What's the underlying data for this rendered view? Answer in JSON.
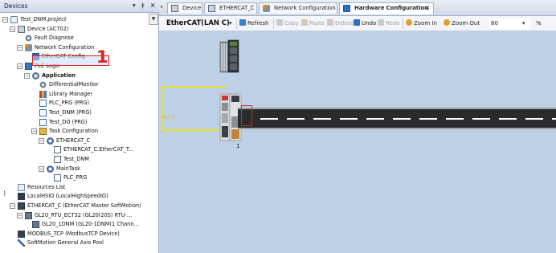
{
  "devices_panel": {
    "title": "Devices",
    "pin_icon": "pin-icon",
    "close_icon": "close-icon",
    "items": [
      {
        "label": "Test_DNM.project",
        "depth": 0,
        "toggle": "−",
        "icon": "project-icon",
        "italic": true
      },
      {
        "label": "Device (AC702)",
        "depth": 1,
        "toggle": "−",
        "icon": "device-icon"
      },
      {
        "label": "Fault Diagnose",
        "depth": 2,
        "toggle": "",
        "icon": "gear-icon"
      },
      {
        "label": "Network Configuration",
        "depth": 2,
        "toggle": "−",
        "icon": "network-icon"
      },
      {
        "label": "EtherCAT Config",
        "depth": 3,
        "toggle": "",
        "icon": "ethercat-icon"
      },
      {
        "label": "PLC Logic",
        "depth": 2,
        "toggle": "−",
        "icon": "plc-icon"
      },
      {
        "label": "Application",
        "depth": 3,
        "toggle": "−",
        "icon": "application-icon",
        "bold": true
      },
      {
        "label": "DifferentialMonitor",
        "depth": 4,
        "toggle": "",
        "icon": "gear-icon"
      },
      {
        "label": "Library Manager",
        "depth": 4,
        "toggle": "",
        "icon": "library-icon"
      },
      {
        "label": "PLC_PRG (PRG)",
        "depth": 4,
        "toggle": "",
        "icon": "pou-icon"
      },
      {
        "label": "Test_DNM (PRG)",
        "depth": 4,
        "toggle": "",
        "icon": "pou-icon"
      },
      {
        "label": "Test_DO (PRG)",
        "depth": 4,
        "toggle": "",
        "icon": "pou-icon"
      },
      {
        "label": "Task Configuration",
        "depth": 4,
        "toggle": "−",
        "icon": "task-config-icon"
      },
      {
        "label": "ETHERCAT_C",
        "depth": 5,
        "toggle": "−",
        "icon": "task-icon"
      },
      {
        "label": "ETHERCAT_C.EtherCAT_T...",
        "depth": 6,
        "toggle": "",
        "icon": "call-icon"
      },
      {
        "label": "Test_DNM",
        "depth": 6,
        "toggle": "",
        "icon": "call-icon"
      },
      {
        "label": "MainTask",
        "depth": 5,
        "toggle": "−",
        "icon": "task-icon"
      },
      {
        "label": "PLC_PRG",
        "depth": 6,
        "toggle": "",
        "icon": "call-icon"
      },
      {
        "label": "Resources List",
        "depth": 1,
        "toggle": "",
        "icon": "resources-icon"
      },
      {
        "label": "LocalHSIO (LocalHighSpeedIO)",
        "depth": 1,
        "toggle": "",
        "icon": "localhsio-icon"
      },
      {
        "label": "ETHERCAT_C (EtherCAT Master SoftMotion)",
        "depth": 1,
        "toggle": "−",
        "icon": "ethercat-master-icon"
      },
      {
        "label": "GL20_RTU_ECT32 (GL20(20S) RTU-...",
        "depth": 2,
        "toggle": "−",
        "icon": "slave-icon"
      },
      {
        "label": "GL20_1DNM (GL20-1DNM(1 Chann...",
        "depth": 3,
        "toggle": "",
        "icon": "slave-icon"
      },
      {
        "label": "MODBUS_TCP (ModbusTCP Device)",
        "depth": 1,
        "toggle": "",
        "icon": "modbus-icon"
      },
      {
        "label": "SoftMotion General Axis Pool",
        "depth": 1,
        "toggle": "",
        "icon": "axis-pool-icon"
      }
    ]
  },
  "annotation": {
    "number": "1"
  },
  "side_mark": ")",
  "tabs": [
    {
      "label": "Device",
      "icon": "device-icon",
      "active": false
    },
    {
      "label": "ETHERCAT_C",
      "icon": "ethercat-icon",
      "active": false
    },
    {
      "label": "Network Configuration",
      "icon": "network-icon",
      "active": false
    },
    {
      "label": "Hardware Configuration",
      "icon": "hardware-config-icon",
      "active": true,
      "close": "×"
    }
  ],
  "toolbar": {
    "selector": "EtherCAT(LAN C)",
    "refresh": "Refresh",
    "copy": "Copy",
    "paste": "Paste",
    "delete": "Delete",
    "undo": "Undo",
    "redo": "Redo",
    "zoom_in": "Zoom In",
    "zoom_out": "Zoom Out",
    "zoom_value": "80",
    "zoom_unit": "%"
  },
  "canvas": {
    "no_label": "No.1",
    "device_number": "1"
  },
  "colors": {
    "canvas": "#bed0e6",
    "wire": "#e8e021",
    "highlight": "#e0231c",
    "bus": "#2a2b2d"
  }
}
